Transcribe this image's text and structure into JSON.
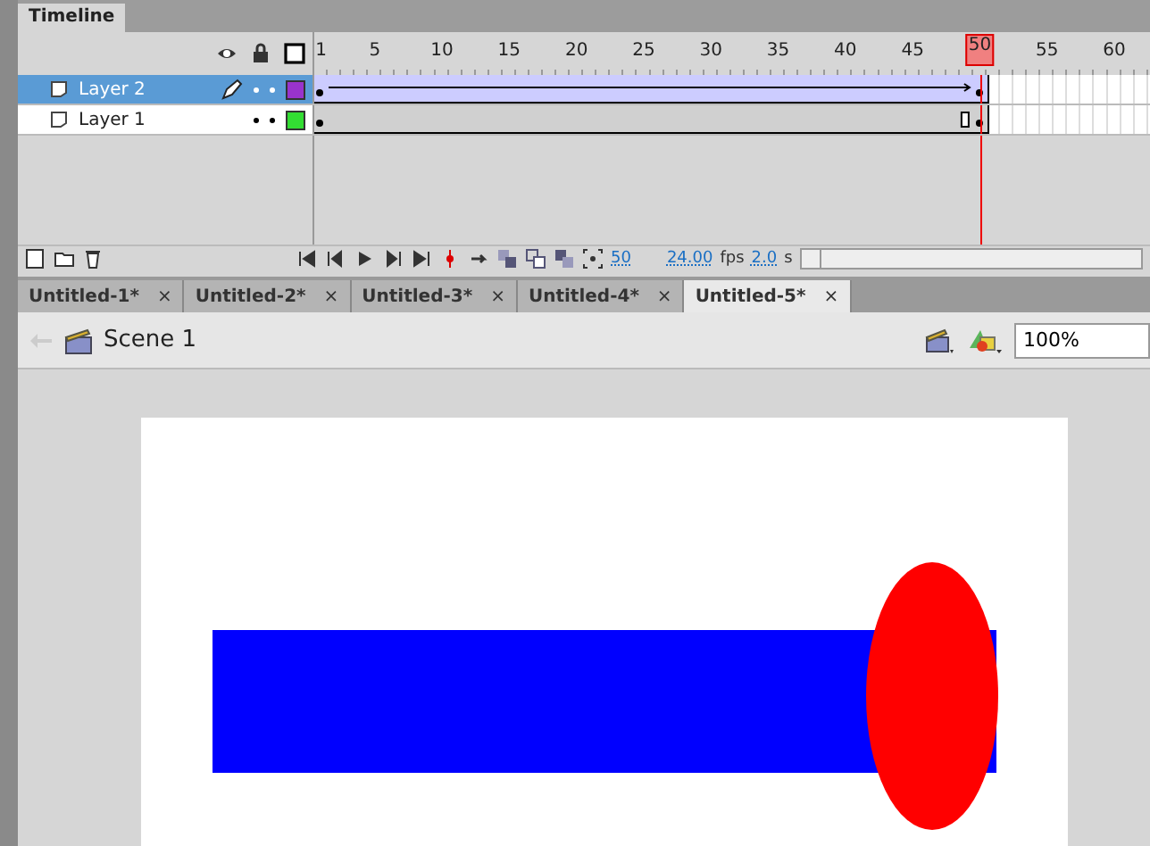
{
  "panel_tab": {
    "label": "Timeline"
  },
  "ruler": [
    {
      "label": "1",
      "selected": false
    },
    {
      "label": "5",
      "selected": false
    },
    {
      "label": "10",
      "selected": false
    },
    {
      "label": "15",
      "selected": false
    },
    {
      "label": "20",
      "selected": false
    },
    {
      "label": "25",
      "selected": false
    },
    {
      "label": "30",
      "selected": false
    },
    {
      "label": "35",
      "selected": false
    },
    {
      "label": "40",
      "selected": false
    },
    {
      "label": "45",
      "selected": false
    },
    {
      "label": "50",
      "selected": true
    },
    {
      "label": "55",
      "selected": false
    },
    {
      "label": "60",
      "selected": false
    }
  ],
  "layers": [
    {
      "name": "Layer 2",
      "selected": true,
      "editing": true,
      "color": "#9933cc",
      "tween": true
    },
    {
      "name": "Layer 1",
      "selected": false,
      "editing": false,
      "color": "#33dd33",
      "tween": false
    }
  ],
  "controls": {
    "frame": "50",
    "fps": "24.00",
    "fps_unit": "fps",
    "time": "2.0",
    "time_unit": "s"
  },
  "doc_tabs": [
    {
      "label": "Untitled-1*",
      "selected": false,
      "close": "×"
    },
    {
      "label": "Untitled-2*",
      "selected": false,
      "close": "×"
    },
    {
      "label": "Untitled-3*",
      "selected": false,
      "close": "×"
    },
    {
      "label": "Untitled-4*",
      "selected": false,
      "close": "×"
    },
    {
      "label": "Untitled-5*",
      "selected": true,
      "close": "×"
    }
  ],
  "scene": {
    "label": "Scene 1",
    "zoom": "100%"
  }
}
